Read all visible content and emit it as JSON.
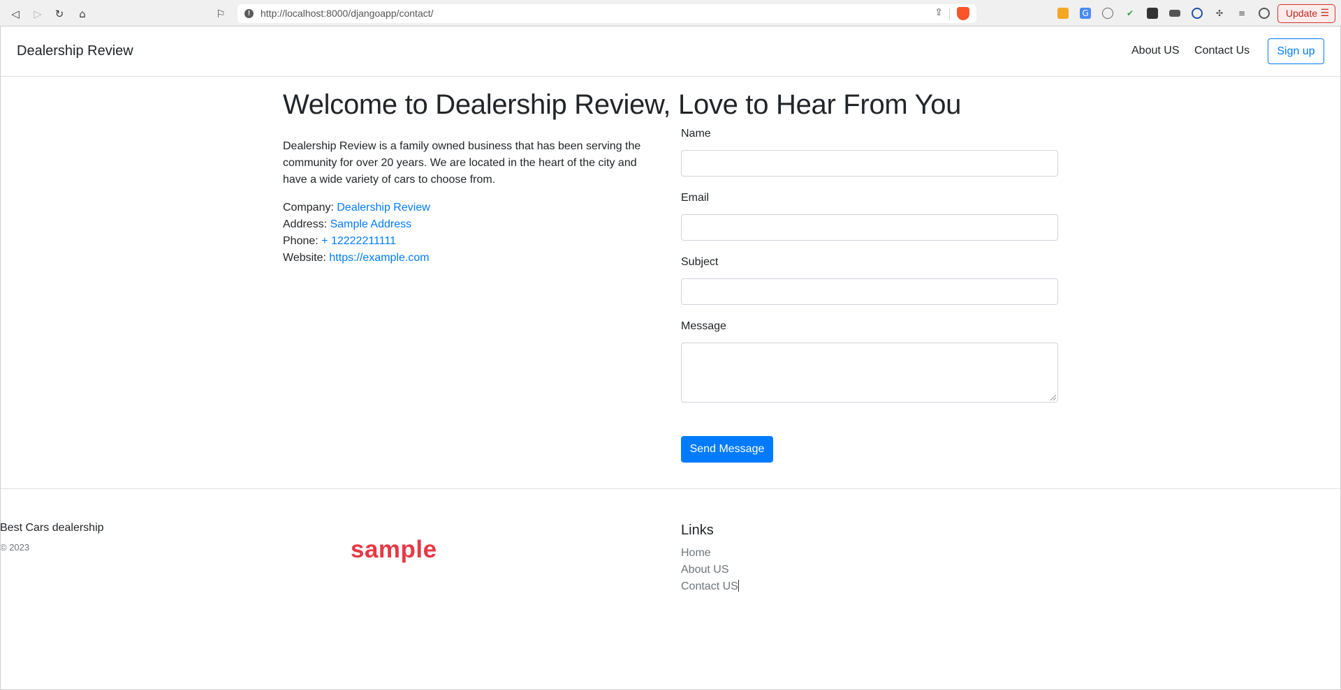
{
  "browser": {
    "url": "http://localhost:8000/djangoapp/contact/",
    "update_label": "Update"
  },
  "navbar": {
    "brand": "Dealership Review",
    "about": "About US",
    "contact": "Contact Us",
    "signup": "Sign up"
  },
  "main": {
    "title": "Welcome to Dealership Review, Love to Hear From You",
    "intro": "Dealership Review is a family owned business that has been serving the community for over 20 years. We are located in the heart of the city and have a wide variety of cars to choose from.",
    "company_label": "Company: ",
    "company_value": "Dealership Review",
    "address_label": "Address: ",
    "address_value": "Sample Address",
    "phone_label": "Phone: ",
    "phone_value": "+ 12222211111",
    "website_label": "Website: ",
    "website_value": "https://example.com"
  },
  "form": {
    "name_label": "Name",
    "name_value": "",
    "email_label": "Email",
    "email_value": "",
    "subject_label": "Subject",
    "subject_value": "",
    "message_label": "Message",
    "message_value": "",
    "submit_label": "Send Message"
  },
  "footer": {
    "brand": "Best Cars dealership",
    "copyright": "© 2023",
    "logo_text": "sample",
    "links_title": "Links",
    "links": [
      "Home",
      "About US",
      "Contact US"
    ]
  },
  "colors": {
    "link": "#007bff",
    "primary_button": "#007bff",
    "logo": "#e63946",
    "muted_text": "#6c757d"
  }
}
